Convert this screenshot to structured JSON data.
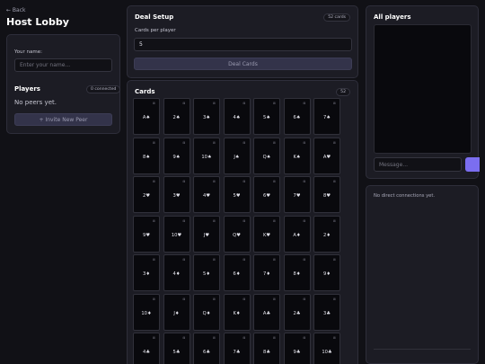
{
  "header": {
    "back_label": "← Back",
    "title": "Host Lobby"
  },
  "lobby": {
    "name_label": "Your name:",
    "name_placeholder": "Enter your name...",
    "name_value": "",
    "players_heading": "Players",
    "connected_badge": "0 connected",
    "no_peers_text": "No peers yet.",
    "invite_button": "+ Invite New Peer"
  },
  "deal_setup": {
    "heading": "Deal Setup",
    "cards_badge": "52 cards",
    "cards_per_player_label": "Cards per player",
    "cards_per_player_value": "5",
    "deal_button": "Deal Cards"
  },
  "cards_panel": {
    "heading": "Cards",
    "count_badge": "52",
    "corner_glyph": "⊠",
    "cards": [
      "A♠",
      "2♠",
      "3♠",
      "4♠",
      "5♠",
      "6♠",
      "7♠",
      "8♠",
      "9♠",
      "10♠",
      "J♠",
      "Q♠",
      "K♠",
      "A♥",
      "2♥",
      "3♥",
      "4♥",
      "5♥",
      "6♥",
      "7♥",
      "8♥",
      "9♥",
      "10♥",
      "J♥",
      "Q♥",
      "K♥",
      "A♦",
      "2♦",
      "3♦",
      "4♦",
      "5♦",
      "6♦",
      "7♦",
      "8♦",
      "9♦",
      "10♦",
      "J♦",
      "Q♦",
      "K♦",
      "A♣",
      "2♣",
      "3♣",
      "4♣",
      "5♣",
      "6♣",
      "7♣",
      "8♣",
      "9♣",
      "10♣"
    ]
  },
  "chat": {
    "heading": "All players",
    "message_placeholder": "Message...",
    "message_value": "",
    "send_label": "",
    "accent_color": "#7b6ef0"
  },
  "direct": {
    "empty_text": "No direct connections yet."
  }
}
